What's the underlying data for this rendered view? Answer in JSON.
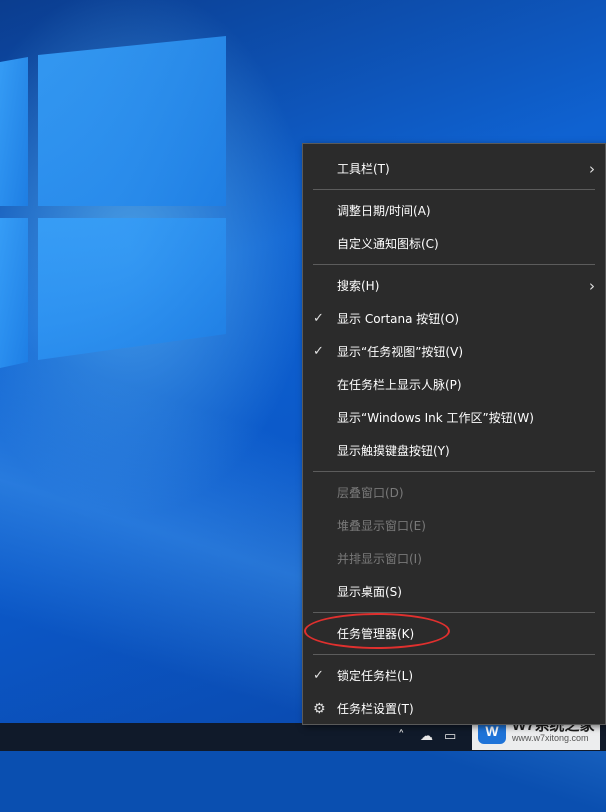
{
  "menu": {
    "items": [
      {
        "label": "工具栏(T)",
        "submenu": true
      },
      {
        "label": "调整日期/时间(A)"
      },
      {
        "label": "自定义通知图标(C)"
      },
      {
        "label": "搜索(H)",
        "submenu": true
      },
      {
        "label": "显示 Cortana 按钮(O)",
        "checked": true
      },
      {
        "label": "显示“任务视图”按钮(V)",
        "checked": true
      },
      {
        "label": "在任务栏上显示人脉(P)"
      },
      {
        "label": "显示“Windows Ink 工作区”按钮(W)"
      },
      {
        "label": "显示触摸键盘按钮(Y)"
      },
      {
        "label": "层叠窗口(D)",
        "disabled": true
      },
      {
        "label": "堆叠显示窗口(E)",
        "disabled": true
      },
      {
        "label": "并排显示窗口(I)",
        "disabled": true
      },
      {
        "label": "显示桌面(S)"
      },
      {
        "label": "任务管理器(K)",
        "highlighted": true
      },
      {
        "label": "锁定任务栏(L)",
        "checked": true
      },
      {
        "label": "任务栏设置(T)",
        "icon": "gear-icon"
      }
    ]
  },
  "glyphs": {
    "check": "✓",
    "chevron": "›",
    "gear": "⚙"
  },
  "watermark": {
    "logo": "W",
    "title": "W7系统之家",
    "url": "www.w7xitong.com"
  },
  "colors": {
    "menu_bg": "#2b2b2b",
    "disabled_text": "#7a7a7a",
    "annotation_red": "#e0302e",
    "desktop_blue": "#0f62d1"
  }
}
